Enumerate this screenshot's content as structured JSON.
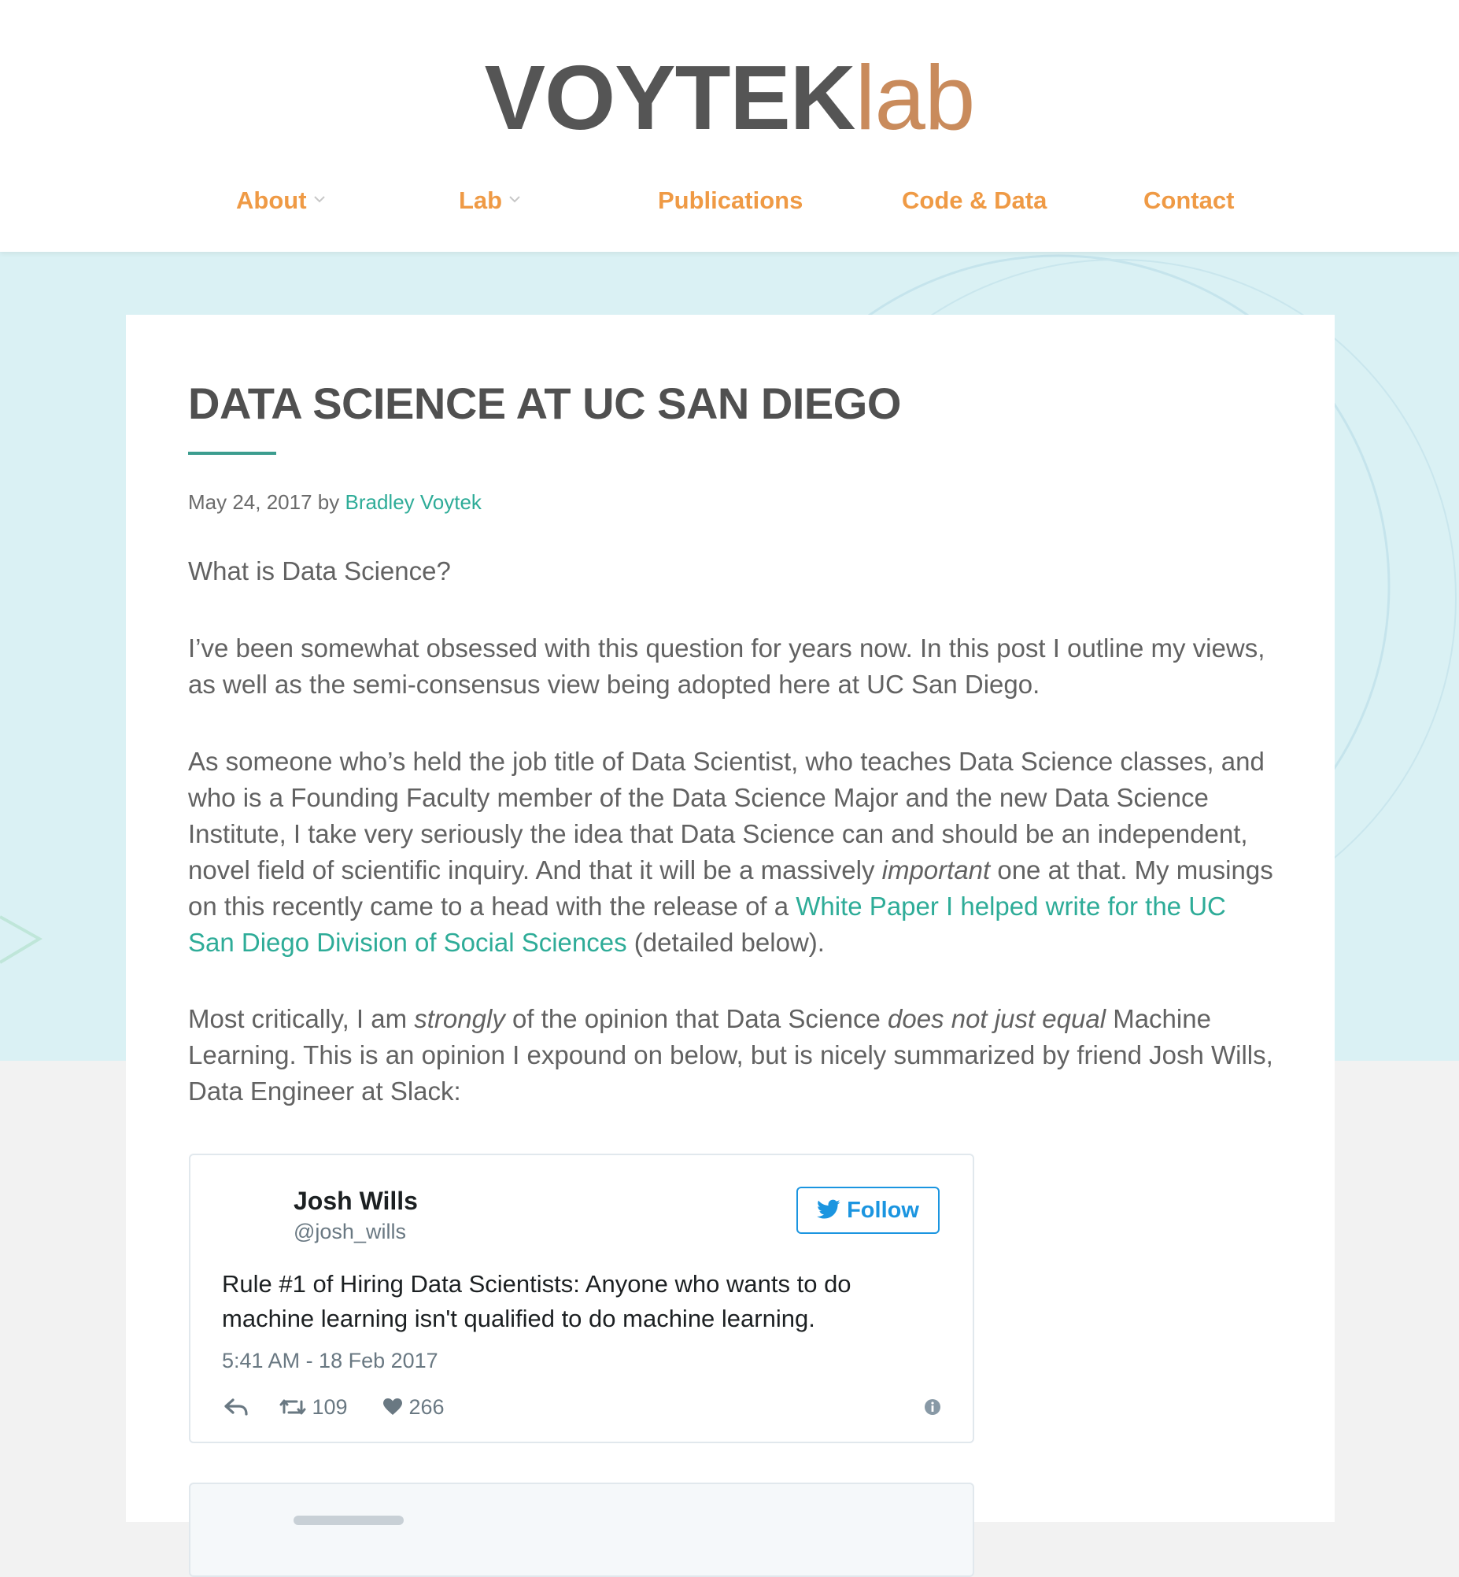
{
  "logo": {
    "main": "VOYTEK",
    "accent": "lab"
  },
  "nav": [
    {
      "label": "About",
      "has_dropdown": true
    },
    {
      "label": "Lab",
      "has_dropdown": true
    },
    {
      "label": "Publications",
      "has_dropdown": false
    },
    {
      "label": "Code & Data",
      "has_dropdown": false
    },
    {
      "label": "Contact",
      "has_dropdown": false
    }
  ],
  "post": {
    "title": "DATA SCIENCE AT UC SAN DIEGO",
    "date": "May 24, 2017",
    "by": "by",
    "author": "Bradley Voytek",
    "p1": "What is Data Science?",
    "p2": "I’ve been somewhat obsessed with this question for years now. In this post I outline my views, as well as the semi-consensus view being adopted here at UC San Diego.",
    "p3_a": "As someone who’s held the job title of Data Scientist, who teaches Data Science classes, and who is a Founding Faculty member of the Data Science Major and the new Data Science Institute, I take very seriously the idea that Data Science can and should be an independent, novel field of scientific inquiry. And that it will be a massively ",
    "p3_em": "important",
    "p3_b": " one at that. My musings on this recently came to a head with the release of a ",
    "p3_link": "White Paper I helped write for the UC San Diego Division of Social Sciences",
    "p3_c": " (detailed below).",
    "p4_a": "Most critically, I am ",
    "p4_em1": "strongly",
    "p4_b": " of the opinion that Data Science ",
    "p4_em2": "does not just equal",
    "p4_c": " Machine Learning. This is an opinion I expound on below, but is nicely summarized by friend Josh Wills, Data Engineer at Slack:"
  },
  "tweet": {
    "name": "Josh Wills",
    "handle": "@josh_wills",
    "follow_label": "Follow",
    "text": "Rule #1 of Hiring Data Scientists: Anyone who wants to do machine learning isn't qualified to do machine learning.",
    "time": "5:41 AM - 18 Feb 2017",
    "retweets": "109",
    "likes": "266"
  },
  "colors": {
    "nav": "#ef9a45",
    "link": "#2eac98",
    "band": "#daf1f4",
    "logo_main": "#555555",
    "logo_accent": "#c98b5c",
    "twitter": "#1b95e0"
  },
  "icons": [
    "chevron-down-icon",
    "twitter-bird-icon",
    "reply-icon",
    "retweet-icon",
    "heart-icon",
    "info-icon"
  ]
}
